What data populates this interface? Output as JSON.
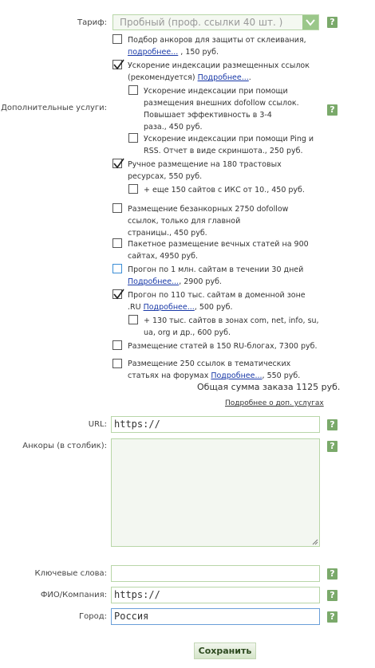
{
  "tariff": {
    "label": "Тариф:",
    "selected": "Пробный (проф. ссылки 40 шт. )"
  },
  "services": {
    "label": "Дополнительные услуги:",
    "options": [
      {
        "l1": "Подбор анкоров для защиты от склеивания,",
        "link": "подробнее...",
        "tail": " , 150 руб.",
        "checked": false
      },
      {
        "l1": "Ускорение индексации размещенных ссылок",
        "l2": "(рекомендуется) ",
        "link": "Подробнее...",
        "tail": ".",
        "checked": true
      },
      {
        "l1": "Ускорение индексации при помощи",
        "l2": "размещения внешних dofollow ссылок.",
        "l3": "Повышает эффективность в 3-4",
        "l4": "раза., 450 руб.",
        "checked": false
      },
      {
        "l1": "Ускорение индексации при помощи Ping и",
        "l2": "RSS. Отчет в виде скриншота., 250 руб.",
        "checked": false
      },
      {
        "l1": "Ручное размещение на 180 трастовых",
        "l2": "ресурсах, 550 руб.",
        "checked": true
      },
      {
        "l1": "+ еще 150 сайтов с ИКС от 10., 450 руб.",
        "checked": false
      },
      {
        "l1": "Размещение безанкорных 2750 dofollow",
        "l2": "ссылок, только для главной",
        "l3": "страницы., 450 руб.",
        "checked": false
      },
      {
        "l1": "Пакетное размещение вечных статей на 900",
        "l2": "сайтах, 4950 руб.",
        "checked": false
      },
      {
        "l1": "Прогон по 1 млн. сайтам в течении 30 дней",
        "link": "Подробнее...",
        "tail": ", 2900 руб.",
        "checked": false
      },
      {
        "l1": "Прогон по 110 тыс. сайтам в доменной зоне",
        "l2": ".RU ",
        "link": "Подробнее...",
        "tail": ", 500 руб.",
        "checked": true
      },
      {
        "l1": "+ 130 тыс. сайтов в зонах com, net, info, su,",
        "l2": "ua, org и др., 600 руб.",
        "checked": false
      },
      {
        "l1": "Размещение статей в 150 RU-блогах, 7300 руб.",
        "checked": false
      },
      {
        "l1": "Размещение 250 ссылок в тематических",
        "l2": "статьях на форумах ",
        "link": "Подробнее...",
        "tail": ", 550 руб.",
        "checked": false
      }
    ],
    "total": "Общая сумма заказа 1125 руб.",
    "more_link": "Подробнее о доп. услугах"
  },
  "url": {
    "label": "URL:",
    "value": "https://"
  },
  "anchors": {
    "label": "Анкоры (в столбик):",
    "value": ""
  },
  "keywords": {
    "label": "Ключевые слова:",
    "value": ""
  },
  "name": {
    "label": "ФИО/Компания:",
    "value": "https://"
  },
  "city": {
    "label": "Город:",
    "value": "Россия"
  },
  "help_glyph": "?",
  "save_label": "Сохранить",
  "colors": {
    "accent": "#7aa96a",
    "link": "#1a3aa8",
    "border": "#b8d6a8"
  }
}
